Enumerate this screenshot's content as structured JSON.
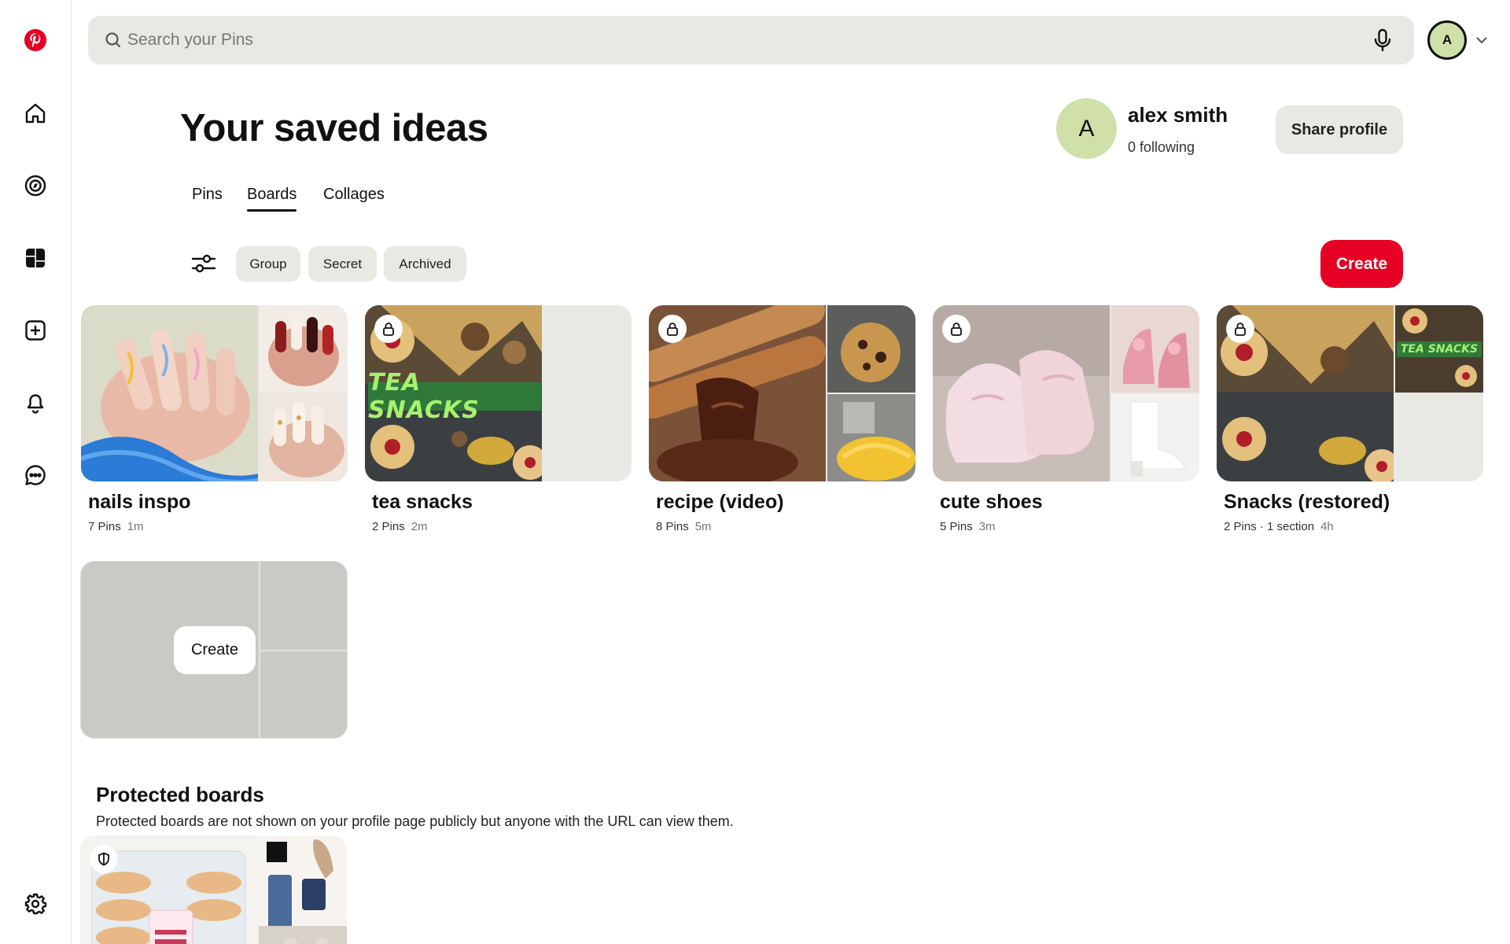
{
  "sidebar": {
    "items": [
      {
        "icon": "pinterest-logo-icon"
      },
      {
        "icon": "home-icon"
      },
      {
        "icon": "explore-icon"
      },
      {
        "icon": "boards-icon"
      },
      {
        "icon": "create-icon"
      },
      {
        "icon": "notifications-icon"
      },
      {
        "icon": "messages-icon"
      },
      {
        "icon": "settings-icon"
      }
    ]
  },
  "search": {
    "placeholder": "Search your Pins"
  },
  "top_avatar": {
    "initial": "A"
  },
  "header": {
    "title": "Your saved ideas",
    "profile": {
      "initial": "A",
      "name": "alex smith",
      "following": "0 following"
    },
    "share_label": "Share profile"
  },
  "tabs": [
    {
      "label": "Pins",
      "active": false
    },
    {
      "label": "Boards",
      "active": true
    },
    {
      "label": "Collages",
      "active": false
    }
  ],
  "filters": {
    "chips": [
      "Group",
      "Secret",
      "Archived"
    ],
    "create_label": "Create"
  },
  "boards": [
    {
      "name": "nails inspo",
      "pins": "7 Pins",
      "age": "1m",
      "secret": false
    },
    {
      "name": "tea snacks",
      "pins": "2 Pins",
      "age": "2m",
      "secret": true,
      "cover_text": "TEA SNACKS"
    },
    {
      "name": "recipe (video)",
      "pins": "8 Pins",
      "age": "5m",
      "secret": true
    },
    {
      "name": "cute shoes",
      "pins": "5 Pins",
      "age": "3m",
      "secret": true
    },
    {
      "name": "Snacks (restored)",
      "pins": "2 Pins · 1 section",
      "age": "4h",
      "secret": true,
      "cover_text": "TEA SNACKS"
    }
  ],
  "empty_board": {
    "create_label": "Create"
  },
  "protected": {
    "title": "Protected boards",
    "subtitle": "Protected boards are not shown on your profile page publicly but anyone with the URL can view them."
  },
  "colors": {
    "brand": "#e60023",
    "chip": "#e9e9e4",
    "avatar": "#cfe0a8"
  }
}
